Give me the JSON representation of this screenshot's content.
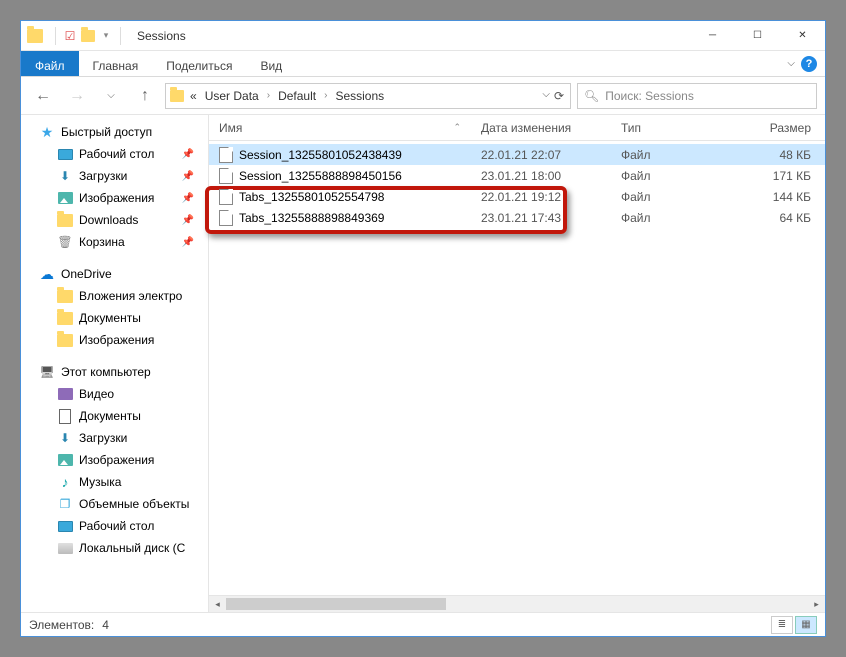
{
  "window": {
    "title": "Sessions"
  },
  "ribbon": {
    "file": "Файл",
    "tabs": [
      "Главная",
      "Поделиться",
      "Вид"
    ]
  },
  "breadcrumbs": {
    "prefix": "«",
    "items": [
      "User Data",
      "Default",
      "Sessions"
    ]
  },
  "search": {
    "placeholder": "Поиск: Sessions"
  },
  "nav": {
    "quick": "Быстрый доступ",
    "quick_items": [
      {
        "label": "Рабочий стол",
        "pin": true,
        "icon": "desktop"
      },
      {
        "label": "Загрузки",
        "pin": true,
        "icon": "down"
      },
      {
        "label": "Изображения",
        "pin": true,
        "icon": "pics"
      },
      {
        "label": "Downloads",
        "pin": true,
        "icon": "folder"
      },
      {
        "label": "Корзина",
        "pin": true,
        "icon": "bin"
      }
    ],
    "onedrive": "OneDrive",
    "onedrive_items": [
      {
        "label": "Вложения электро",
        "icon": "folder"
      },
      {
        "label": "Документы",
        "icon": "folder"
      },
      {
        "label": "Изображения",
        "icon": "folder"
      }
    ],
    "thispc": "Этот компьютер",
    "pc_items": [
      {
        "label": "Видео",
        "icon": "video"
      },
      {
        "label": "Документы",
        "icon": "docs"
      },
      {
        "label": "Загрузки",
        "icon": "down"
      },
      {
        "label": "Изображения",
        "icon": "pics"
      },
      {
        "label": "Музыка",
        "icon": "music"
      },
      {
        "label": "Объемные объекты",
        "icon": "3d"
      },
      {
        "label": "Рабочий стол",
        "icon": "desktop"
      },
      {
        "label": "Локальный диск (C",
        "icon": "disk"
      }
    ]
  },
  "cols": {
    "name": "Имя",
    "date": "Дата изменения",
    "type": "Тип",
    "size": "Размер"
  },
  "files": [
    {
      "name": "Session_13255801052438439",
      "date": "22.01.21 22:07",
      "type": "Файл",
      "size": "48 КБ",
      "sel": true
    },
    {
      "name": "Session_13255888898450156",
      "date": "23.01.21 18:00",
      "type": "Файл",
      "size": "171 КБ",
      "sel": false
    },
    {
      "name": "Tabs_13255801052554798",
      "date": "22.01.21 19:12",
      "type": "Файл",
      "size": "144 КБ",
      "sel": false
    },
    {
      "name": "Tabs_13255888898849369",
      "date": "23.01.21 17:43",
      "type": "Файл",
      "size": "64 КБ",
      "sel": false
    }
  ],
  "status": {
    "count_label": "Элементов:",
    "count": "4"
  }
}
